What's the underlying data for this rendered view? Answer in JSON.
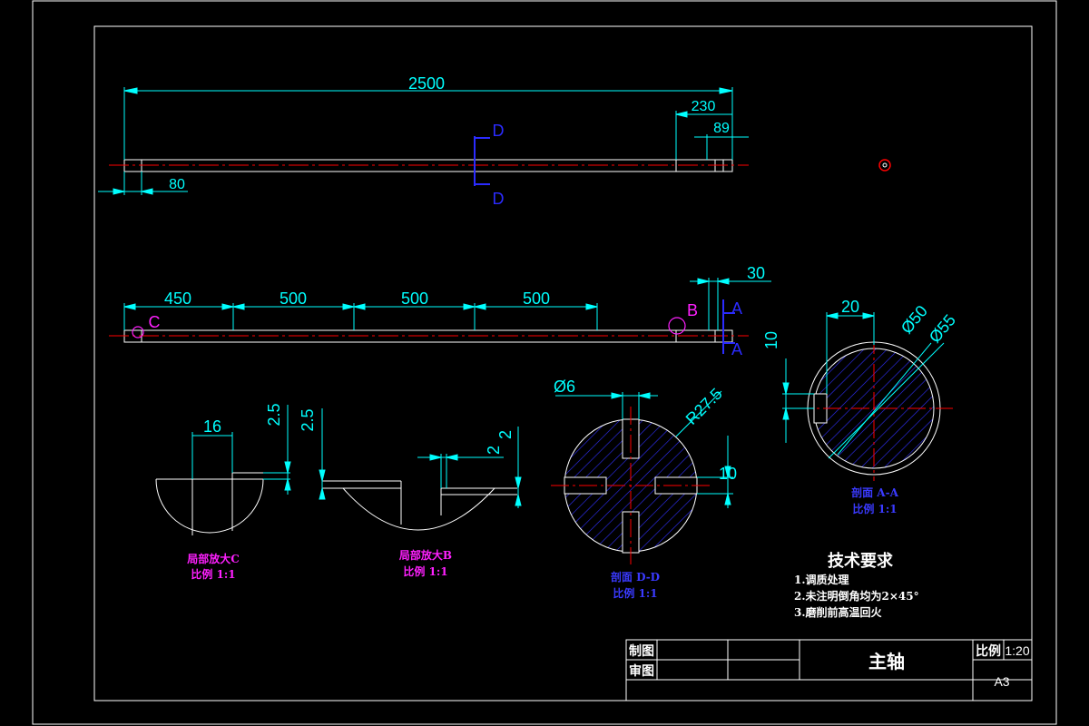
{
  "colors": {
    "background": "#000000",
    "outline": "#ffffff",
    "dimension": "#00ffff",
    "centerline": "#ff0000",
    "section_label": "#2b2bff",
    "detail_caption": "#ff20ff",
    "hatch": "#3030ff"
  },
  "top_view": {
    "dim_total": "2500",
    "dim_right_step": "230",
    "dim_right_end": "89",
    "dim_left_end": "80",
    "section_mark": "D"
  },
  "side_view": {
    "segments": [
      "450",
      "500",
      "500",
      "500"
    ],
    "dim_end": "30",
    "detail_c": "C",
    "detail_b": "B",
    "section_mark": "A"
  },
  "detail_c": {
    "dim_width": "16",
    "dim_height": "2.5",
    "caption": "局部放大C",
    "scale": "比例 1:1"
  },
  "detail_b": {
    "dim_left": "2.5",
    "dim_step": "2",
    "dim_right": "2",
    "caption": "局部放大B",
    "scale": "比例 1:1"
  },
  "section_dd": {
    "dim_hole": "Ø6",
    "dim_radius": "R27.5",
    "dim_slot": "10",
    "caption": "剖面 D-D",
    "scale": "比例 1:1"
  },
  "section_aa": {
    "dim_width": "20",
    "dim_inner": "Ø50",
    "dim_outer": "Ø55",
    "dim_depth": "10",
    "caption": "剖面 A-A",
    "scale": "比例 1:1"
  },
  "tech_requirements": {
    "title": "技术要求",
    "items": [
      "1.调质处理",
      "2.未注明倒角均为2×45°",
      "3.磨削前高温回火"
    ]
  },
  "title_block": {
    "drawn_label": "制图",
    "checked_label": "审图",
    "part_name": "主轴",
    "scale_label": "比例",
    "scale_value": "1:20",
    "sheet_size": "A3"
  }
}
